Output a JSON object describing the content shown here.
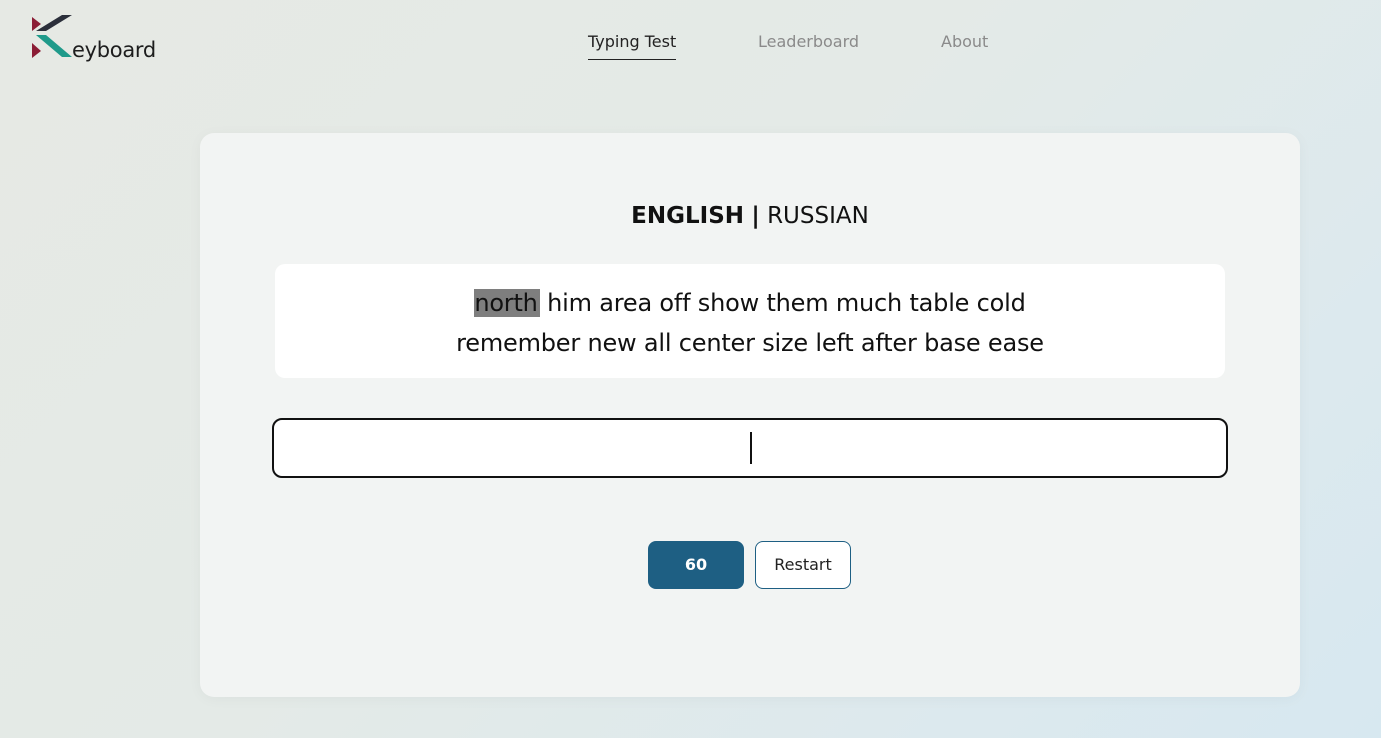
{
  "app": {
    "logo_text": "eyboard",
    "colors": {
      "logo_dark": "#2b2f3a",
      "logo_teal": "#1f9a8a",
      "logo_red": "#8b1d35",
      "accent": "#1e5f83",
      "highlight": "#7e7e7e"
    }
  },
  "nav": {
    "items": [
      {
        "label": "Typing Test",
        "active": true
      },
      {
        "label": "Leaderboard",
        "active": false
      },
      {
        "label": "About",
        "active": false
      }
    ]
  },
  "language": {
    "english": "ENGLISH",
    "separator": "|",
    "russian": "RUSSIAN",
    "selected": "ENGLISH"
  },
  "words": {
    "current": "north",
    "line1_rest": "him area off show them much table cold",
    "line2": "remember new all center size left after base ease"
  },
  "typing_input": {
    "value": ""
  },
  "controls": {
    "timer": "60",
    "restart_label": "Restart"
  }
}
